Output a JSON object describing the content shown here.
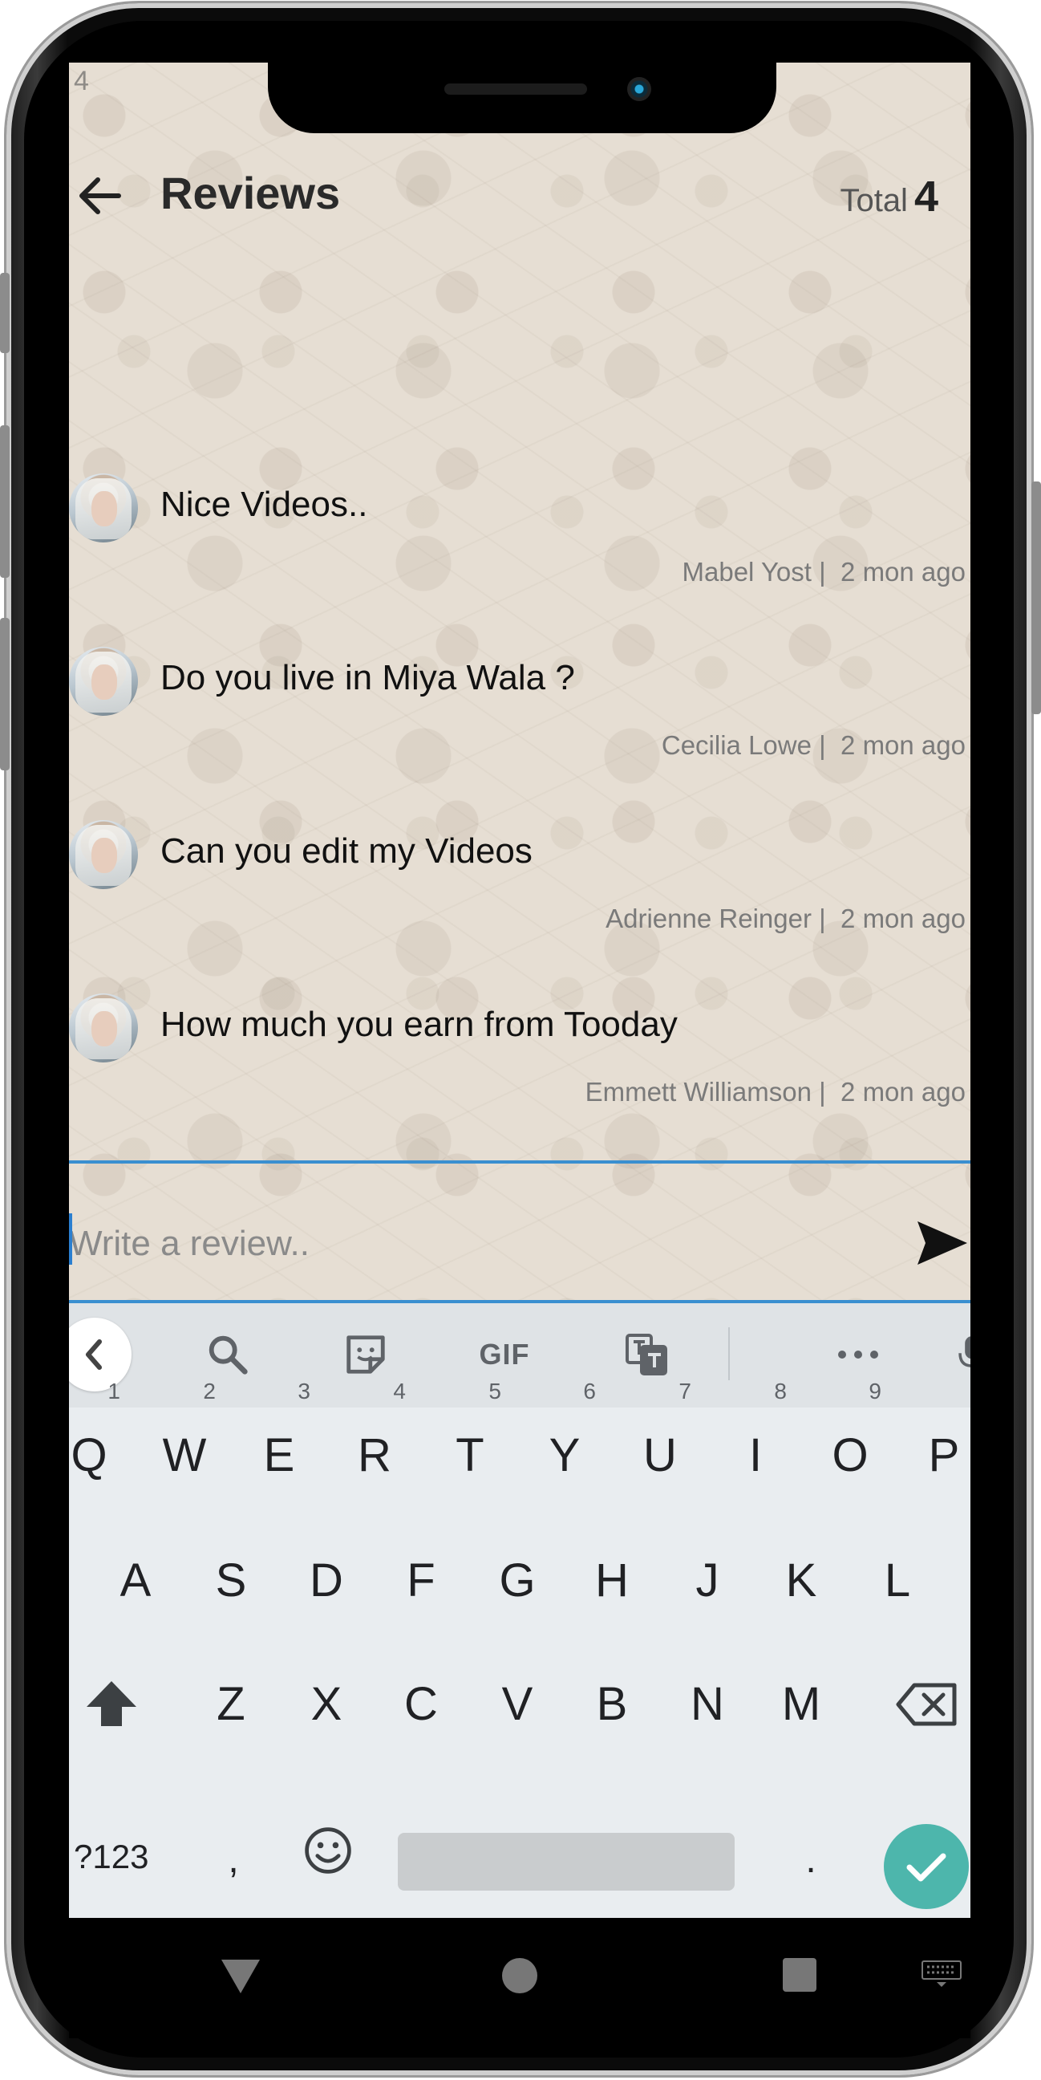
{
  "status": {
    "left": "4",
    "right": ""
  },
  "header": {
    "title": "Reviews",
    "total_label": "Total",
    "total_count": "4"
  },
  "reviews": [
    {
      "text": "Nice Videos..",
      "author": "Mabel Yost",
      "time": "2 mon ago"
    },
    {
      "text": "Do you live in Miya Wala ?",
      "author": "Cecilia Lowe",
      "time": "2 mon ago"
    },
    {
      "text": "Can you edit my Videos",
      "author": "Adrienne Reinger",
      "time": "2 mon ago"
    },
    {
      "text": "How much you earn from Tooday",
      "author": "Emmett Williamson",
      "time": "2 mon ago"
    }
  ],
  "composer": {
    "placeholder": "Write a review.."
  },
  "keyboard": {
    "toolbar": {
      "gif": "GIF"
    },
    "row1": [
      {
        "key": "Q",
        "hint": "1"
      },
      {
        "key": "W",
        "hint": "2"
      },
      {
        "key": "E",
        "hint": "3"
      },
      {
        "key": "R",
        "hint": "4"
      },
      {
        "key": "T",
        "hint": "5"
      },
      {
        "key": "Y",
        "hint": "6"
      },
      {
        "key": "U",
        "hint": "7"
      },
      {
        "key": "I",
        "hint": "8"
      },
      {
        "key": "O",
        "hint": "9"
      },
      {
        "key": "P",
        "hint": ""
      }
    ],
    "row2": [
      "A",
      "S",
      "D",
      "F",
      "G",
      "H",
      "J",
      "K",
      "L"
    ],
    "row3": [
      "Z",
      "X",
      "C",
      "V",
      "B",
      "N",
      "M"
    ],
    "symbols": "?123",
    "comma": ",",
    "period": "."
  },
  "colors": {
    "accent": "#3a8fd0",
    "enter": "#4db6ac"
  }
}
